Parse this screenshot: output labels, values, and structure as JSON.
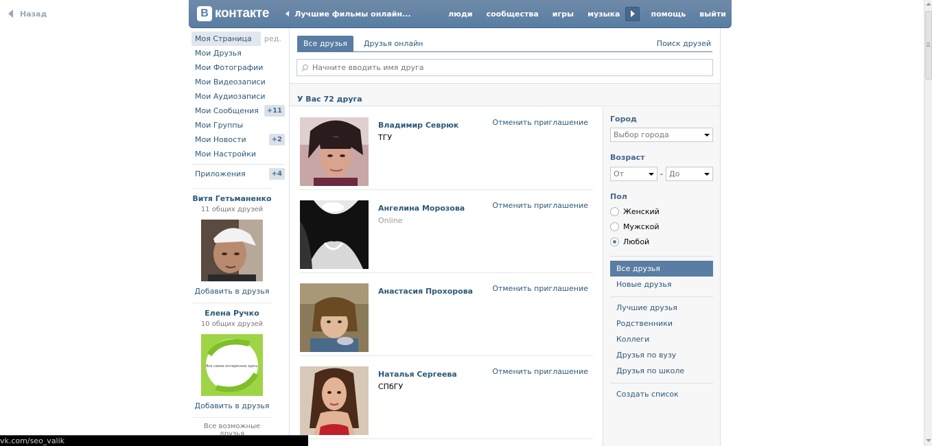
{
  "back": {
    "label": "Назад"
  },
  "header": {
    "logo_letter": "В",
    "logo_text": "контакте",
    "promo": "Лучшие фильмы онлайн...",
    "nav": [
      "люди",
      "сообщества",
      "игры",
      "музыка",
      "помощь",
      "выйти"
    ]
  },
  "left_menu": {
    "items": [
      {
        "label": "Моя Страница",
        "extra": "ред."
      },
      {
        "label": "Мои Друзья"
      },
      {
        "label": "Мои Фотографии"
      },
      {
        "label": "Мои Видеозаписи"
      },
      {
        "label": "Мои Аудиозаписи"
      },
      {
        "label": "Мои Сообщения",
        "count": "+11"
      },
      {
        "label": "Мои Группы"
      },
      {
        "label": "Мои Новости",
        "count": "+2"
      },
      {
        "label": "Мои Настройки"
      }
    ],
    "apps": {
      "label": "Приложения",
      "count": "+4"
    }
  },
  "suggestions": [
    {
      "name": "Витя Гетьманенко",
      "mutual": "11 общих друзей",
      "add": "Добавить в друзья"
    },
    {
      "name": "Елена Ручко",
      "mutual": "10 общих друзей",
      "add": "Добавить в друзья",
      "photo_text": "Все самое интересное здесь"
    }
  ],
  "all_possible": "Все возможные друзья",
  "tabs": [
    {
      "label": "Все друзья",
      "active": true
    },
    {
      "label": "Друзья онлайн",
      "active": false
    }
  ],
  "find_friends": "Поиск друзей",
  "search": {
    "placeholder": "Начните вводить имя друга"
  },
  "summary": "У Вас 72 друга",
  "friends": [
    {
      "name": "Владимир Севрюк",
      "sub": "ТГУ",
      "action": "Отменить приглашение"
    },
    {
      "name": "Ангелина Морозова",
      "sub": "Online",
      "action": "Отменить приглашение"
    },
    {
      "name": "Анастасия Прохорова",
      "sub": "",
      "action": "Отменить приглашение"
    },
    {
      "name": "Наталья Сергеева",
      "sub": "СПбГУ",
      "action": "Отменить приглашение"
    }
  ],
  "filters": {
    "city_label": "Город",
    "city_value": "Выбор города",
    "age_label": "Возраст",
    "age_from": "От",
    "age_to": "До",
    "age_sep": "-",
    "sex_label": "Пол",
    "sex_options": [
      {
        "label": "Женский",
        "selected": false
      },
      {
        "label": "Мужской",
        "selected": false
      },
      {
        "label": "Любой",
        "selected": true
      }
    ],
    "lists_primary": [
      "Все друзья",
      "Новые друзья"
    ],
    "lists": [
      "Лучшие друзья",
      "Родственники",
      "Коллеги",
      "Друзья по вузу",
      "Друзья по школе"
    ],
    "create_list": "Создать список"
  },
  "status_bar": "vk.com/seo_valik",
  "colors": {
    "accent": "#597da3",
    "link": "#2b587a"
  }
}
